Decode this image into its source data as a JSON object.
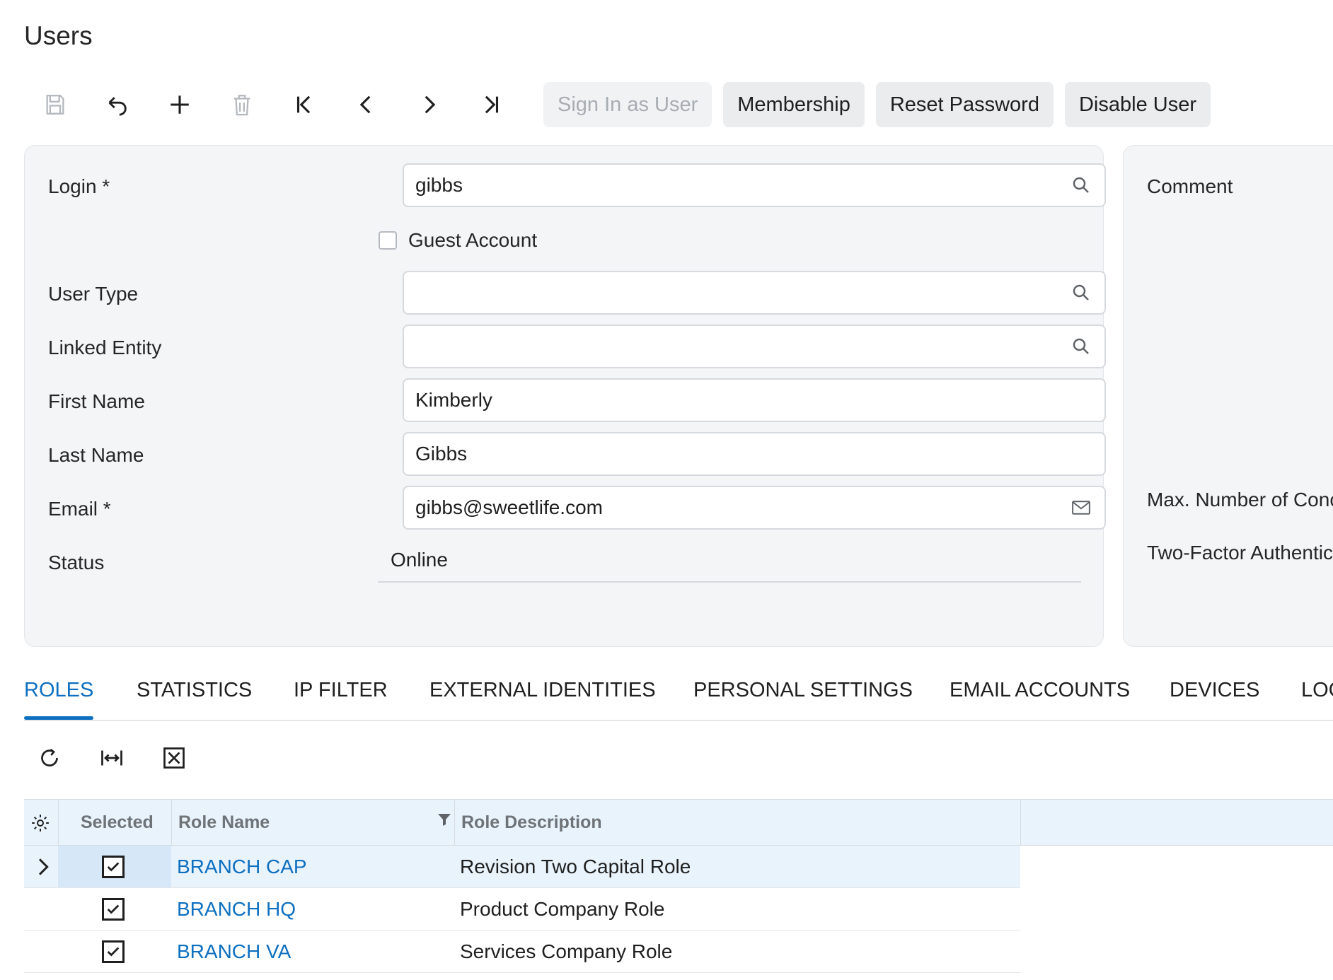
{
  "page": {
    "title": "Users"
  },
  "toolbar": {
    "icons": [
      "save-icon",
      "undo-icon",
      "add-icon",
      "delete-icon",
      "first-record-icon",
      "previous-icon",
      "next-icon",
      "last-record-icon"
    ],
    "sign_in_as_user": "Sign In as User",
    "membership": "Membership",
    "reset_password": "Reset Password",
    "disable_user": "Disable User"
  },
  "form": {
    "login": {
      "label": "Login *",
      "value": "gibbs"
    },
    "guest_account": {
      "label": "Guest Account",
      "checked": false
    },
    "user_type": {
      "label": "User Type",
      "value": ""
    },
    "linked_entity": {
      "label": "Linked Entity",
      "value": ""
    },
    "first_name": {
      "label": "First Name",
      "value": "Kimberly"
    },
    "last_name": {
      "label": "Last Name",
      "value": "Gibbs"
    },
    "email": {
      "label": "Email *",
      "value": "gibbs@sweetlife.com"
    },
    "status": {
      "label": "Status",
      "value": "Online"
    }
  },
  "right_panel": {
    "comment_label": "Comment",
    "max_connections_label": "Max. Number of Conc",
    "two_factor_label": "Two-Factor Authentic"
  },
  "tabs": [
    {
      "label": "ROLES",
      "active": true
    },
    {
      "label": "STATISTICS",
      "active": false
    },
    {
      "label": "IP FILTER",
      "active": false
    },
    {
      "label": "EXTERNAL IDENTITIES",
      "active": false
    },
    {
      "label": "PERSONAL SETTINGS",
      "active": false
    },
    {
      "label": "EMAIL ACCOUNTS",
      "active": false
    },
    {
      "label": "DEVICES",
      "active": false
    },
    {
      "label": "LOC",
      "active": false
    }
  ],
  "grid_toolbar": {
    "icons": [
      "refresh-icon",
      "fit-columns-icon",
      "export-excel-icon"
    ]
  },
  "grid": {
    "columns": [
      "Selected",
      "Role Name",
      "Role Description"
    ],
    "rows": [
      {
        "selected": true,
        "role_name": "BRANCH CAP",
        "role_description": "Revision Two Capital Role",
        "current": true
      },
      {
        "selected": true,
        "role_name": "BRANCH HQ",
        "role_description": "Product Company Role",
        "current": false
      },
      {
        "selected": true,
        "role_name": "BRANCH VA",
        "role_description": "Services Company Role",
        "current": false
      }
    ]
  },
  "colors": {
    "accent": "#0d6fc0",
    "panel_bg": "#f4f5f7",
    "grid_header_bg": "#e9f3fb"
  }
}
